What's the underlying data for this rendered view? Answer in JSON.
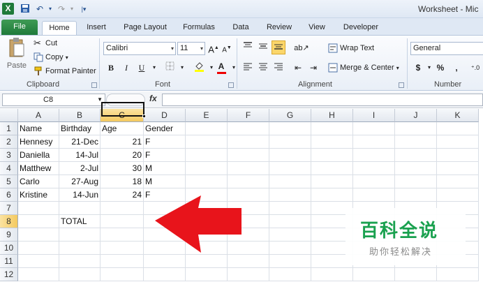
{
  "window": {
    "title": "Worksheet - Mic",
    "app_icon": "X"
  },
  "quick_access": {
    "save_icon": "save-icon",
    "undo_icon": "undo-icon",
    "redo_icon": "redo-icon",
    "customize_icon": "customize-icon"
  },
  "tabs": [
    {
      "label": "File"
    },
    {
      "label": "Home"
    },
    {
      "label": "Insert"
    },
    {
      "label": "Page Layout"
    },
    {
      "label": "Formulas"
    },
    {
      "label": "Data"
    },
    {
      "label": "Review"
    },
    {
      "label": "View"
    },
    {
      "label": "Developer"
    }
  ],
  "ribbon": {
    "clipboard": {
      "label": "Clipboard",
      "paste": "Paste",
      "cut": "Cut",
      "copy": "Copy",
      "format_painter": "Format Painter"
    },
    "font": {
      "label": "Font",
      "font_name": "Calibri",
      "font_size": "11",
      "grow": "A",
      "shrink": "A",
      "bold": "B",
      "italic": "I",
      "underline": "U",
      "font_color_letter": "A"
    },
    "alignment": {
      "label": "Alignment",
      "wrap_text": "Wrap Text",
      "merge_center": "Merge & Center"
    },
    "number": {
      "label": "Number",
      "format": "General",
      "currency": "$",
      "percent": "%",
      "comma": ","
    }
  },
  "formula_bar": {
    "name_box": "C8",
    "fx": "fx",
    "formula": ""
  },
  "columns": [
    "A",
    "B",
    "C",
    "D",
    "E",
    "F",
    "G",
    "H",
    "I",
    "J",
    "K"
  ],
  "selected_column": "C",
  "rows": [
    "1",
    "2",
    "3",
    "4",
    "5",
    "6",
    "7",
    "8",
    "9",
    "10",
    "11",
    "12"
  ],
  "selected_row": "8",
  "sheet": {
    "header": {
      "name": "Name",
      "birthday": "Birthday",
      "age": "Age",
      "gender": "Gender"
    },
    "records": [
      {
        "name": "Hennesy",
        "birthday": "21-Dec",
        "age": "21",
        "gender": "F"
      },
      {
        "name": "Daniella",
        "birthday": "14-Jul",
        "age": "20",
        "gender": "F"
      },
      {
        "name": "Matthew",
        "birthday": "2-Jul",
        "age": "30",
        "gender": "M"
      },
      {
        "name": "Carlo",
        "birthday": "27-Aug",
        "age": "18",
        "gender": "M"
      },
      {
        "name": "Kristine",
        "birthday": "14-Jun",
        "age": "24",
        "gender": "F"
      }
    ],
    "total_label": "TOTAL"
  },
  "annotation": {
    "arrow_color": "#e8141b"
  },
  "watermark": {
    "title": "百科全说",
    "subtitle": "助你轻松解决",
    "color": "#1aa14f"
  }
}
